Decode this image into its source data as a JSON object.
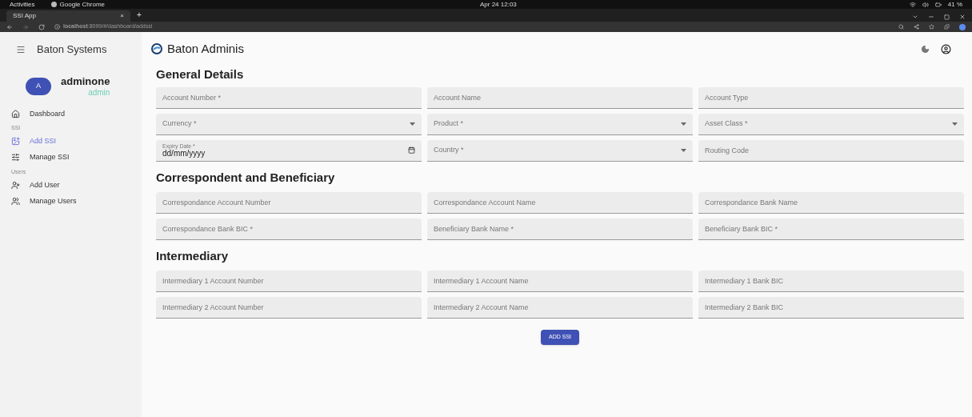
{
  "system_bar": {
    "activities": "Activities",
    "app": "Google Chrome",
    "clock": "Apr 24 12:03",
    "battery": "41 %"
  },
  "browser": {
    "tabs": [
      {
        "label": "SSI App",
        "close": "×",
        "selected": true
      }
    ],
    "new_tab": "+",
    "url": "**localhost**:8099/#/dashboard/addssi"
  },
  "sidebar": {
    "title": "Baton Systems",
    "user": {
      "initial": "A",
      "name": "adminone",
      "role": "admin"
    },
    "items": [
      {
        "kind": "link",
        "label": "Dashboard",
        "selected": false
      },
      {
        "kind": "section",
        "label": "SSI"
      },
      {
        "kind": "link",
        "label": "Add SSI",
        "selected": true
      },
      {
        "kind": "link",
        "label": "Manage SSI",
        "selected": false
      },
      {
        "kind": "section",
        "label": "Users"
      },
      {
        "kind": "link",
        "label": "Add User",
        "selected": false
      },
      {
        "kind": "link",
        "label": "Manage Users",
        "selected": false
      }
    ]
  },
  "header": {
    "title": "Baton Adminis"
  },
  "sections": [
    {
      "heading": "General Details",
      "fields": [
        {
          "kind": "text",
          "placeholder": "Account Number *"
        },
        {
          "kind": "text",
          "placeholder": "Account Name"
        },
        {
          "kind": "text",
          "placeholder": "Account Type"
        },
        {
          "kind": "select",
          "placeholder": "Currency *"
        },
        {
          "kind": "select",
          "placeholder": "Product *"
        },
        {
          "kind": "select",
          "placeholder": "Asset Class *"
        },
        {
          "kind": "date",
          "label": "Expiry Date *",
          "value": "dd/mm/yyyy"
        },
        {
          "kind": "select",
          "placeholder": "Country *"
        },
        {
          "kind": "text",
          "placeholder": "Routing Code"
        }
      ]
    },
    {
      "heading": "Correspondent and Beneficiary",
      "fields": [
        {
          "kind": "text",
          "placeholder": "Correspondance Account Number"
        },
        {
          "kind": "text",
          "placeholder": "Correspondance Account Name"
        },
        {
          "kind": "text",
          "placeholder": "Correspondance Bank Name"
        },
        {
          "kind": "text",
          "placeholder": "Correspondance Bank BIC *"
        },
        {
          "kind": "text",
          "placeholder": "Beneficiary Bank Name *"
        },
        {
          "kind": "text",
          "placeholder": "Beneficiary Bank BIC *"
        }
      ]
    },
    {
      "heading": "Intermediary",
      "fields": [
        {
          "kind": "text",
          "placeholder": "Intermediary 1 Account Number"
        },
        {
          "kind": "text",
          "placeholder": "Intermediary 1 Account Name"
        },
        {
          "kind": "text",
          "placeholder": "Intermediary 1 Bank BIC"
        },
        {
          "kind": "text",
          "placeholder": "Intermediary 2 Account Number"
        },
        {
          "kind": "text",
          "placeholder": "Intermediary 2 Account Name"
        },
        {
          "kind": "text",
          "placeholder": "Intermediary 2 Bank BIC"
        }
      ]
    }
  ],
  "submit": "ADD SSI"
}
